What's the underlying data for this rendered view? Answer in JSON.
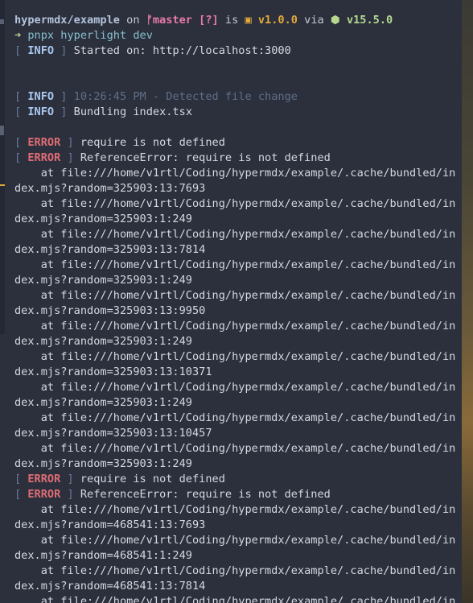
{
  "colors": {
    "background": "#2b303c",
    "text": "#d4d8e0",
    "info": "#aac8f0",
    "error": "#e06c75",
    "branch": "#e87aa8",
    "version": "#e3a93b",
    "node": "#b6d98f",
    "command": "#88c0d0",
    "timestamp": "#616e88"
  },
  "prompt": {
    "path": "hypermdx/example",
    "on": " on ",
    "branch_icon": "branch-icon",
    "branch": "master",
    "status": " [?]",
    "is": " is ",
    "package_icon": "package-icon",
    "version": "v1.0.0",
    "via": " via ",
    "node_icon": "nodejs-icon",
    "node_version": "v15.5.0",
    "arrow": "➜ ",
    "command": "pnpx hyperlight dev"
  },
  "log": {
    "info_tag": "INFO",
    "error_tag": "ERROR",
    "bracket_open": "[ ",
    "bracket_close": " ]",
    "started": " Started on: http://localhost:3000",
    "timestamp": " 10:26:45 PM - Detected file change",
    "bundling": " Bundling index.tsx",
    "require_msg": " require is not defined",
    "ref_error": " ReferenceError: require is not defined",
    "errors": [
      {
        "trace": [
          "    at file:///home/v1rtl/Coding/hypermdx/example/.cache/bundled/in",
          "dex.mjs?random=325903:13:7693",
          "    at file:///home/v1rtl/Coding/hypermdx/example/.cache/bundled/in",
          "dex.mjs?random=325903:1:249",
          "    at file:///home/v1rtl/Coding/hypermdx/example/.cache/bundled/in",
          "dex.mjs?random=325903:13:7814",
          "    at file:///home/v1rtl/Coding/hypermdx/example/.cache/bundled/in",
          "dex.mjs?random=325903:1:249",
          "    at file:///home/v1rtl/Coding/hypermdx/example/.cache/bundled/in",
          "dex.mjs?random=325903:13:9950",
          "    at file:///home/v1rtl/Coding/hypermdx/example/.cache/bundled/in",
          "dex.mjs?random=325903:1:249",
          "    at file:///home/v1rtl/Coding/hypermdx/example/.cache/bundled/in",
          "dex.mjs?random=325903:13:10371",
          "    at file:///home/v1rtl/Coding/hypermdx/example/.cache/bundled/in",
          "dex.mjs?random=325903:1:249",
          "    at file:///home/v1rtl/Coding/hypermdx/example/.cache/bundled/in",
          "dex.mjs?random=325903:13:10457",
          "    at file:///home/v1rtl/Coding/hypermdx/example/.cache/bundled/in",
          "dex.mjs?random=325903:1:249"
        ]
      },
      {
        "trace": [
          "    at file:///home/v1rtl/Coding/hypermdx/example/.cache/bundled/in",
          "dex.mjs?random=468541:13:7693",
          "    at file:///home/v1rtl/Coding/hypermdx/example/.cache/bundled/in",
          "dex.mjs?random=468541:1:249",
          "    at file:///home/v1rtl/Coding/hypermdx/example/.cache/bundled/in",
          "dex.mjs?random=468541:13:7814",
          "    at file:///home/v1rtl/Coding/hypermdx/example/.cache/bundled/in"
        ]
      }
    ]
  }
}
